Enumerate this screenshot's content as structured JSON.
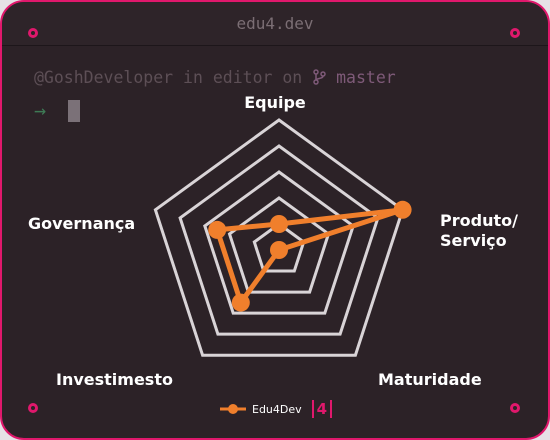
{
  "window": {
    "title": "edu4.dev"
  },
  "terminal": {
    "user": "@GoshDeveloper",
    "in_word": "in",
    "dir": "editor",
    "on_word": "on",
    "branch": "master",
    "prompt_symbol": "→"
  },
  "colors": {
    "accent": "#e0186c",
    "series": "#f07f2c",
    "grid": "#d9d4d7",
    "background": "#2c2227"
  },
  "chart_data": {
    "type": "radar",
    "axes": [
      "Equipe",
      "Produto/ Serviço",
      "Maturidade",
      "Investimesto",
      "Governança"
    ],
    "levels": 5,
    "range": [
      0,
      5
    ],
    "series": [
      {
        "name": "Edu4Dev",
        "values": [
          1,
          5,
          0,
          2.5,
          2.5
        ]
      }
    ],
    "legend_position": "bottom"
  },
  "legend": {
    "label": "Edu4Dev",
    "logo_text": "4"
  }
}
